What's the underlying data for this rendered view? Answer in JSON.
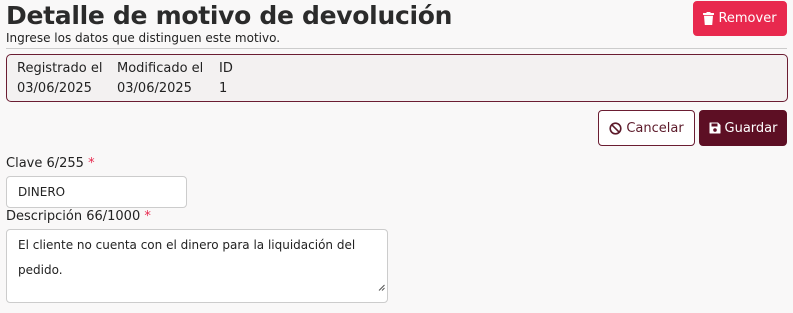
{
  "header": {
    "title": "Detalle de motivo de devolución",
    "subtitle": "Ingrese los datos que distinguen este motivo."
  },
  "actions": {
    "remove_label": "Remover",
    "cancel_label": "Cancelar",
    "save_label": "Guardar"
  },
  "meta": {
    "registered_label": "Registrado el",
    "registered_value": "03/06/2025",
    "modified_label": "Modificado el",
    "modified_value": "03/06/2025",
    "id_label": "ID",
    "id_value": "1"
  },
  "form": {
    "clave": {
      "label": "Clave 6/255",
      "required_mark": "*",
      "value": "DINERO"
    },
    "descripcion": {
      "label": "Descripción 66/1000",
      "required_mark": "*",
      "value": "El cliente no cuenta con el dinero para la liquidación del pedido."
    }
  },
  "icons": {
    "remove": "trash-icon",
    "cancel": "ban-icon",
    "save": "floppy-disk-icon"
  },
  "colors": {
    "danger": "#e8294e",
    "primary": "#5d0f24",
    "border_accent": "#6b1d32"
  }
}
